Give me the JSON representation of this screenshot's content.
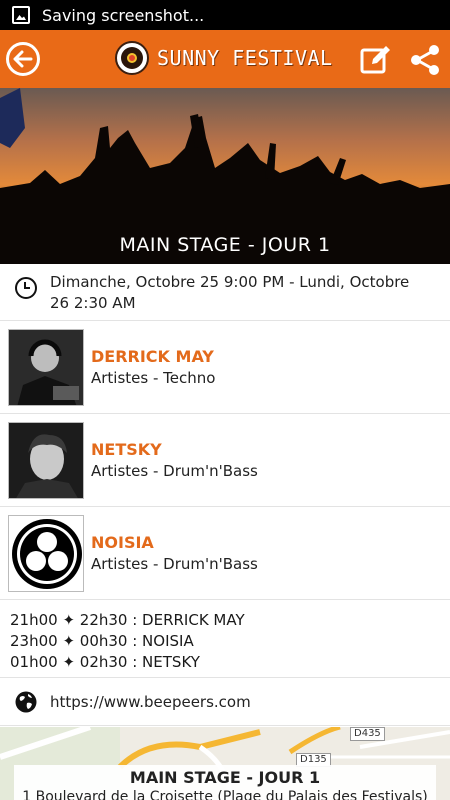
{
  "status_bar": {
    "text": "Saving screenshot..."
  },
  "app_bar": {
    "brand": "SUNNY FESTIVAL"
  },
  "colors": {
    "accent": "#e96a17",
    "artist_name": "#e36a1b"
  },
  "hero": {
    "title": "MAIN STAGE - JOUR 1"
  },
  "event": {
    "date_range": "Dimanche, Octobre 25 9:00 PM - Lundi, Octobre 26 2:30 AM"
  },
  "artists": [
    {
      "name": "DERRICK MAY",
      "genre": "Artistes - Techno",
      "photo": "dj-portrait"
    },
    {
      "name": "NETSKY",
      "genre": "Artistes - Drum'n'Bass",
      "photo": "portrait"
    },
    {
      "name": "NOISIA",
      "genre": "Artistes - Drum'n'Bass",
      "photo": "noisia-logo"
    }
  ],
  "schedule": [
    "21h00 ✦ 22h30 : DERRICK MAY",
    "23h00 ✦ 00h30 : NOISIA",
    "01h00 ✦ 02h30 : NETSKY"
  ],
  "website": {
    "url": "https://www.beepeers.com"
  },
  "map": {
    "road_labels": [
      "D435",
      "D135"
    ],
    "venue": "MAIN STAGE - JOUR 1",
    "address": "1 Boulevard de la Croisette (Plage du Palais des Festivals)"
  },
  "icons": [
    "image-icon",
    "back-arrow-icon",
    "festival-logo-icon",
    "edit-icon",
    "share-icon",
    "clock-icon",
    "globe-icon"
  ]
}
